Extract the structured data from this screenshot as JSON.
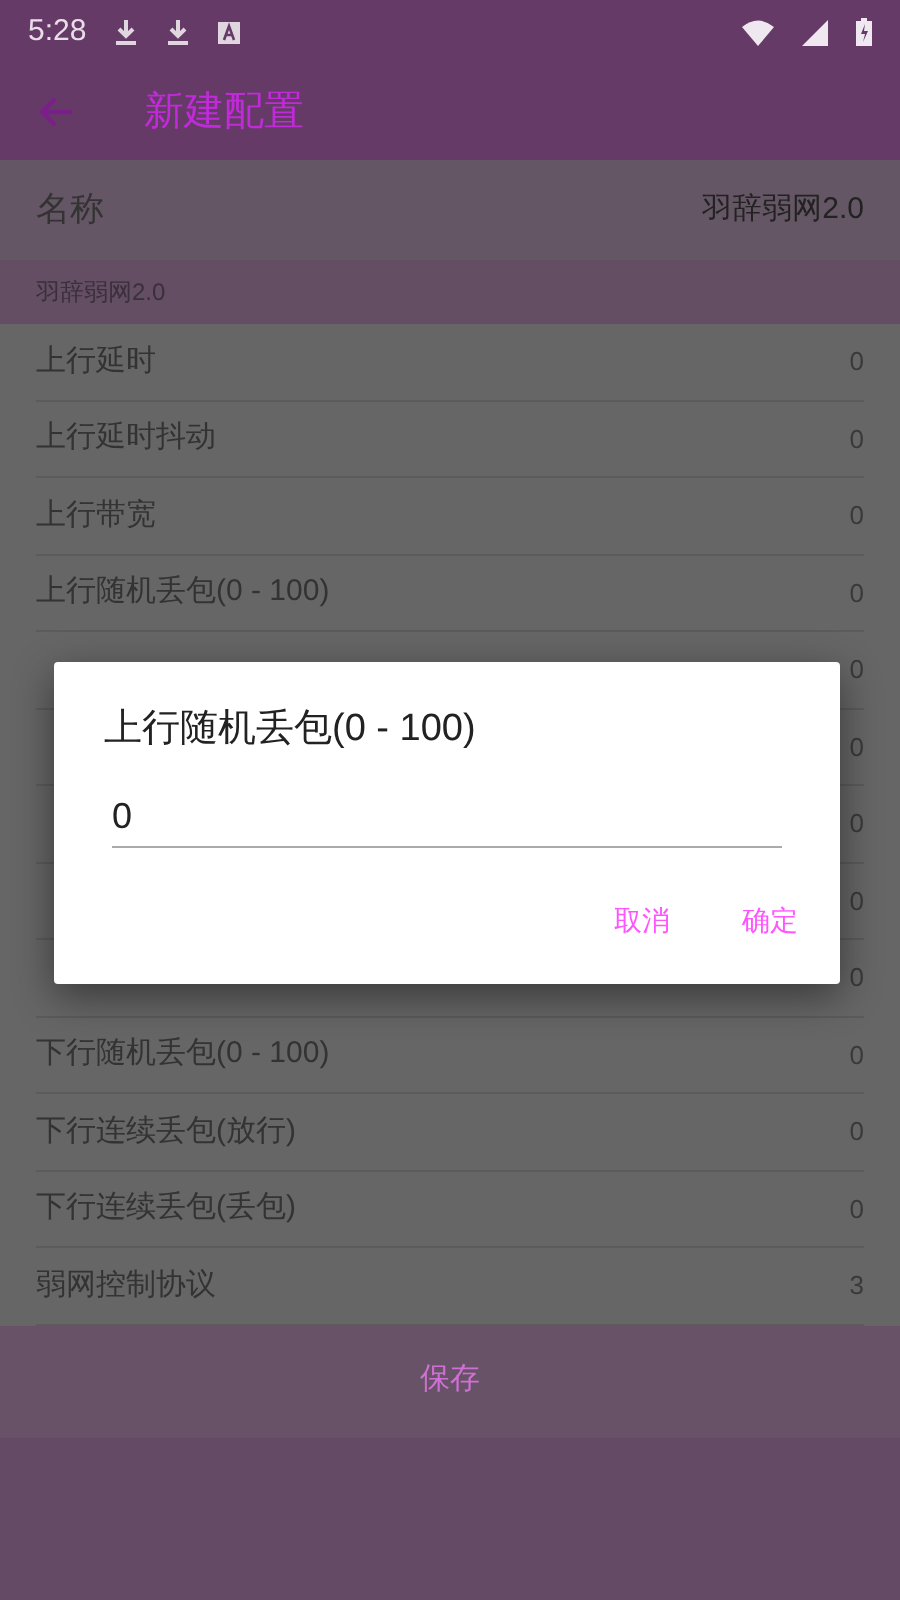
{
  "status_bar": {
    "time": "5:28"
  },
  "toolbar": {
    "title": "新建配置"
  },
  "name_row": {
    "label": "名称",
    "value": "羽辞弱网2.0"
  },
  "section_header": "羽辞弱网2.0",
  "rows": [
    {
      "label": "上行延时",
      "value": "0"
    },
    {
      "label": "上行延时抖动",
      "value": "0"
    },
    {
      "label": "上行带宽",
      "value": "0"
    },
    {
      "label": "上行随机丢包(0 - 100)",
      "value": "0"
    },
    {
      "value": "0"
    },
    {
      "value": "0"
    },
    {
      "value": "0"
    },
    {
      "value": "0"
    },
    {
      "value": "0"
    },
    {
      "label": "下行随机丢包(0 - 100)",
      "value": "0"
    },
    {
      "label": "下行连续丢包(放行)",
      "value": "0"
    },
    {
      "label": "下行连续丢包(丢包)",
      "value": "0"
    },
    {
      "label": "弱网控制协议",
      "value": "3"
    }
  ],
  "save_button": "保存",
  "dialog": {
    "title": "上行随机丢包(0 - 100)",
    "value": "0",
    "buttons": [
      "取消",
      "确定"
    ]
  }
}
